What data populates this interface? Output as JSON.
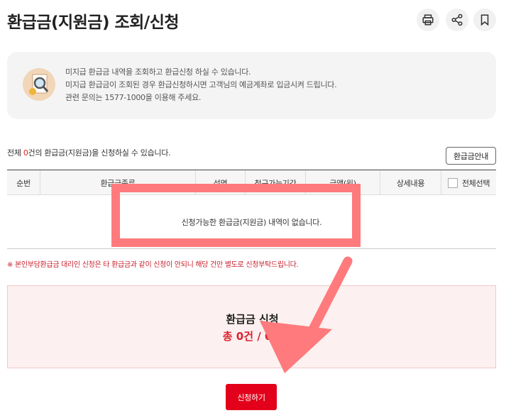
{
  "header": {
    "title": "환급금(지원금) 조회/신청",
    "tools": [
      {
        "name": "print",
        "icon": "printer-icon"
      },
      {
        "name": "share",
        "icon": "share-icon"
      },
      {
        "name": "bookmark",
        "icon": "bookmark-icon"
      }
    ]
  },
  "info": {
    "icon": "magnifier-document-icon",
    "lines": [
      "미지급 환급금 내역을 조회하고 환급신청 하실 수 있습니다.",
      "미지급 환급금이 조회된 경우 환급신청하시면 고객님의 예금계좌로 입금시켜 드립니다.",
      "관련 문의는 1577-1000을 이용해 주세요."
    ]
  },
  "count": {
    "prefix": "전체 ",
    "number": "0",
    "suffix": "건의 환급금(지원금)을 신청하실 수 있습니다."
  },
  "guide_button": "환급금안내",
  "table": {
    "columns": [
      "순번",
      "환급금종류",
      "성명",
      "청구가능기간",
      "금액(원)",
      "상세내용",
      "전체선택"
    ],
    "empty_message": "신청가능한 환급금(지원금) 내역이 없습니다."
  },
  "notice": "※ 본인부담환급금 대리인 신청은 타 환급금과 같이 신청이 안되니 해당 건만 별도로 신청부탁드립니다.",
  "summary": {
    "title": "환급금 신청",
    "total": "총 0건 / 0원"
  },
  "apply_button": "신청하기",
  "colors": {
    "accent_red": "#e2001a",
    "highlight": "#ff7a7c",
    "summary_bg": "#fdf0f0"
  }
}
